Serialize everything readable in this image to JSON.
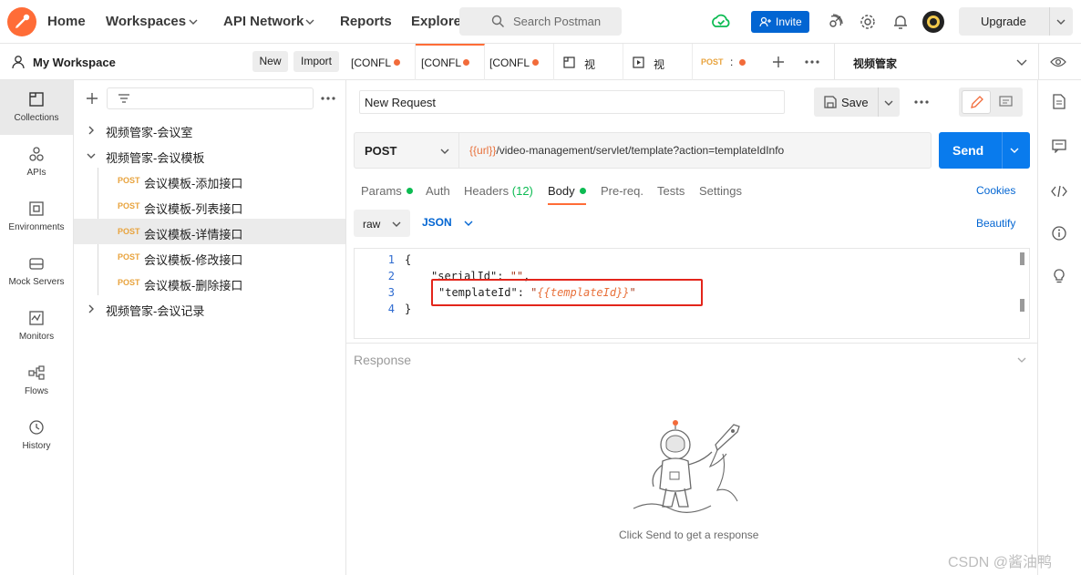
{
  "topbar": {
    "nav": [
      "Home",
      "Workspaces",
      "API Network",
      "Reports",
      "Explore"
    ],
    "search_placeholder": "Search Postman",
    "invite": "Invite",
    "upgrade": "Upgrade"
  },
  "workspace": {
    "name": "My Workspace",
    "new": "New",
    "import": "Import"
  },
  "tabs": [
    {
      "label": "[CONFL"
    },
    {
      "label": "[CONFL"
    },
    {
      "label": "[CONFL"
    },
    {
      "label": "视"
    },
    {
      "label": "视"
    },
    {
      "method": "POST",
      "label": ":"
    }
  ],
  "environment": "视频管家",
  "rail": [
    "Collections",
    "APIs",
    "Environments",
    "Mock Servers",
    "Monitors",
    "Flows",
    "History"
  ],
  "tree": [
    {
      "label": "视频管家-会议室",
      "expanded": false
    },
    {
      "label": "视频管家-会议模板",
      "expanded": true,
      "children": [
        {
          "method": "POST",
          "label": "会议模板-添加接口"
        },
        {
          "method": "POST",
          "label": "会议模板-列表接口"
        },
        {
          "method": "POST",
          "label": "会议模板-详情接口"
        },
        {
          "method": "POST",
          "label": "会议模板-修改接口"
        },
        {
          "method": "POST",
          "label": "会议模板-删除接口"
        }
      ]
    },
    {
      "label": "视频管家-会议记录",
      "expanded": false
    }
  ],
  "request": {
    "name": "New Request",
    "save": "Save",
    "method": "POST",
    "url_var": "{{url}}",
    "url_rest": "/video-management/servlet/template?action=templateIdInfo",
    "send": "Send"
  },
  "subtabs": {
    "params": "Params",
    "auth": "Auth",
    "headers": "Headers",
    "headers_count": "(12)",
    "body": "Body",
    "prereq": "Pre-req.",
    "tests": "Tests",
    "settings": "Settings",
    "cookies": "Cookies"
  },
  "body": {
    "mode": "raw",
    "format": "JSON",
    "beautify": "Beautify",
    "line_numbers": [
      "1",
      "2",
      "3",
      "4"
    ],
    "open_brace": "{",
    "close_brace": "}",
    "key1": "\"serialId\"",
    "val1": "\"\"",
    "key2": "\"templateId\"",
    "val2_var": "{{templateId}}",
    "quote": "\""
  },
  "response": {
    "title": "Response",
    "hint": "Click Send to get a response"
  },
  "watermark": "CSDN @酱油鸭",
  "colors": {
    "accent": "#ff6c37",
    "primary": "#0265d2",
    "highlight_box": "#e3251b"
  }
}
